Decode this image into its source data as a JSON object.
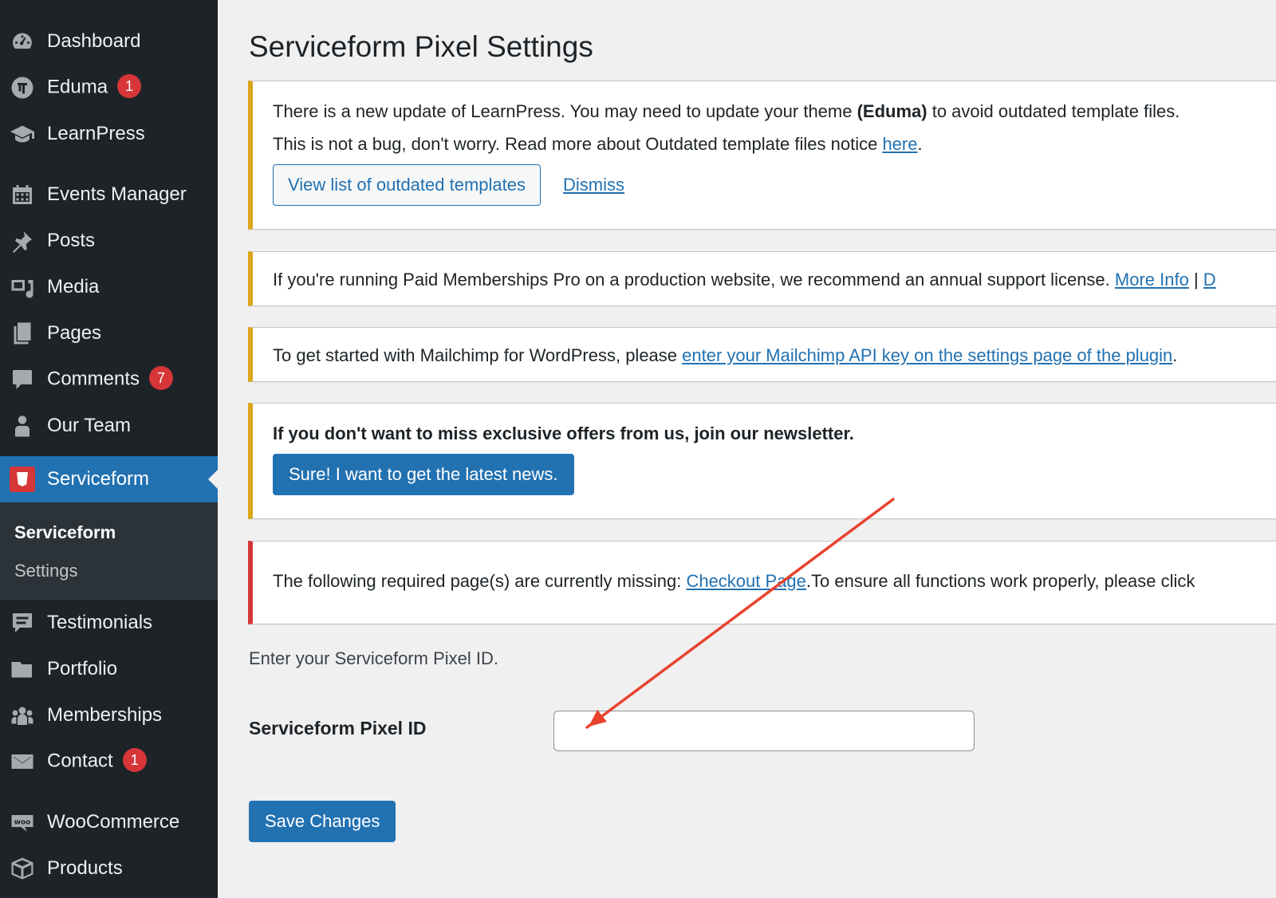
{
  "sidebar": {
    "items": [
      {
        "label": "Dashboard",
        "icon": "dashboard-icon"
      },
      {
        "label": "Eduma",
        "icon": "eduma-icon",
        "badge": "1"
      },
      {
        "label": "LearnPress",
        "icon": "graduation-cap-icon"
      },
      {
        "label": "Events Manager",
        "icon": "calendar-icon"
      },
      {
        "label": "Posts",
        "icon": "pin-icon"
      },
      {
        "label": "Media",
        "icon": "media-icon"
      },
      {
        "label": "Pages",
        "icon": "pages-icon"
      },
      {
        "label": "Comments",
        "icon": "comment-icon",
        "badge": "7"
      },
      {
        "label": "Our Team",
        "icon": "team-icon"
      },
      {
        "label": "Serviceform",
        "icon": "serviceform-icon"
      },
      {
        "label": "Testimonials",
        "icon": "testimonial-icon"
      },
      {
        "label": "Portfolio",
        "icon": "folder-icon"
      },
      {
        "label": "Memberships",
        "icon": "groups-icon"
      },
      {
        "label": "Contact",
        "icon": "email-icon",
        "badge": "1"
      },
      {
        "label": "WooCommerce",
        "icon": "woo-icon"
      },
      {
        "label": "Products",
        "icon": "box-icon"
      }
    ],
    "submenu": {
      "current": "Serviceform",
      "settings": "Settings"
    }
  },
  "page": {
    "title": "Serviceform Pixel Settings"
  },
  "notices": {
    "learnpress": {
      "line1_before": "There is a new update of LearnPress. You may need to update your theme ",
      "line1_bold": "(Eduma)",
      "line1_after": " to avoid outdated template files.",
      "line2_before": "This is not a bug, don't worry. Read more about Outdated template files notice ",
      "line2_link": "here",
      "line2_after": ".",
      "view_button": "View list of outdated templates",
      "dismiss": "Dismiss"
    },
    "pmpro": {
      "text": "If you're running Paid Memberships Pro on a production website, we recommend an annual support license. ",
      "link": "More Info",
      "separator": " | ",
      "trailing": "D"
    },
    "mailchimp": {
      "text": "To get started with Mailchimp for WordPress, please ",
      "link": "enter your Mailchimp API key on the settings page of the plugin",
      "after": "."
    },
    "newsletter": {
      "text": "If you don't want to miss exclusive offers from us, join our newsletter.",
      "button": "Sure! I want to get the latest news."
    },
    "missing_pages": {
      "text": "The following required page(s) are currently missing: ",
      "link": "Checkout Page",
      "after": ".To ensure all functions work properly, please click"
    }
  },
  "form": {
    "description": "Enter your Serviceform Pixel ID.",
    "pixel_label": "Serviceform Pixel ID",
    "pixel_value": "",
    "save_button": "Save Changes"
  },
  "colors": {
    "sidebar_bg": "#1d2327",
    "active_blue": "#2271b1",
    "warning_border": "#dba617",
    "error_border": "#d63638",
    "annotation_arrow": "#e8432f"
  }
}
